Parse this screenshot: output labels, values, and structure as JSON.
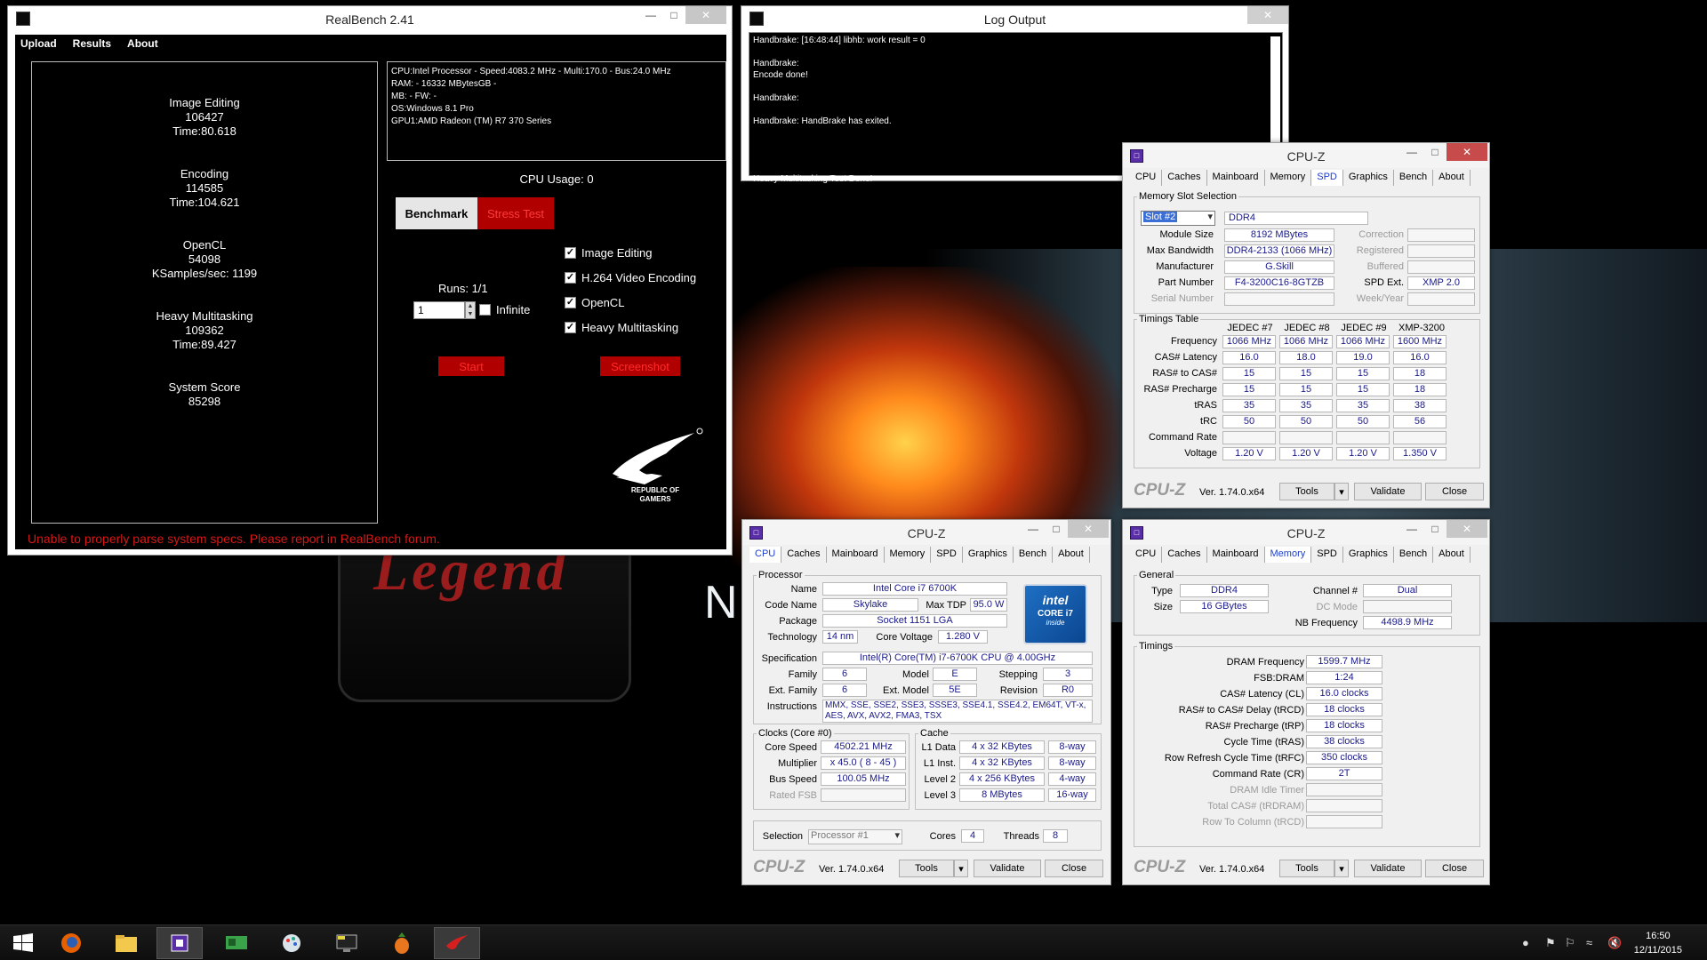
{
  "desktop": {
    "slogan": "N",
    "logo_word": "Legend"
  },
  "realbench": {
    "title": "RealBench 2.41",
    "menu": [
      "Upload",
      "Results",
      "About"
    ],
    "scores": [
      {
        "name": "Image Editing",
        "score": "106427",
        "detail": "Time:80.618"
      },
      {
        "name": "Encoding",
        "score": "114585",
        "detail": "Time:104.621"
      },
      {
        "name": "OpenCL",
        "score": "54098",
        "detail": "KSamples/sec: 1199"
      },
      {
        "name": "Heavy Multitasking",
        "score": "109362",
        "detail": "Time:89.427"
      },
      {
        "name": "System Score",
        "score": "85298",
        "detail": ""
      }
    ],
    "specs": [
      "CPU:Intel Processor - Speed:4083.2 MHz - Multi:170.0 - Bus:24.0 MHz",
      "RAM: - 16332 MBytesGB -",
      "MB: - FW: -",
      "OS:Windows 8.1 Pro",
      "GPU1:AMD Radeon (TM) R7 370 Series"
    ],
    "cpu_usage": "CPU Usage: 0",
    "benchmark_label": "Benchmark",
    "stress_label": "Stress Test",
    "runs_label": "Runs: 1/1",
    "runs_value": "1",
    "infinite_label": "Infinite",
    "tests": [
      "Image Editing",
      "H.264 Video Encoding",
      "OpenCL",
      "Heavy Multitasking"
    ],
    "start_label": "Start",
    "screenshot_label": "Screenshot",
    "rog_text": [
      "REPUBLIC OF",
      "GAMERS"
    ],
    "error": "Unable to properly parse system specs. Please report in RealBench forum."
  },
  "log": {
    "title": "Log Output",
    "lines": [
      "Handbrake: [16:48:44] libhb: work result = 0",
      "",
      "Handbrake:",
      "Encode done!",
      "",
      "Handbrake:",
      "",
      "Handbrake: HandBrake has exited.",
      "",
      "",
      "",
      "",
      "Heavy Multitasking Test Done!"
    ]
  },
  "cpuz_common": {
    "title": "CPU-Z",
    "tabs": [
      "CPU",
      "Caches",
      "Mainboard",
      "Memory",
      "SPD",
      "Graphics",
      "Bench",
      "About"
    ],
    "brand": "CPU-Z",
    "version": "Ver. 1.74.0.x64",
    "tools_label": "Tools",
    "validate_label": "Validate",
    "close_label": "Close"
  },
  "spd": {
    "group_slot": "Memory Slot Selection",
    "slot": "Slot #2",
    "type": "DDR4",
    "module_size": "8192 MBytes",
    "max_bandwidth": "DDR4-2133 (1066 MHz)",
    "manufacturer": "G.Skill",
    "part_number": "F4-3200C16-8GTZB",
    "serial_number": "",
    "correction": "",
    "registered": "",
    "buffered": "",
    "spd_ext": "XMP 2.0",
    "week_year": "",
    "labels": {
      "module_size": "Module Size",
      "max_bandwidth": "Max Bandwidth",
      "manufacturer": "Manufacturer",
      "part_number": "Part Number",
      "serial_number": "Serial Number",
      "correction": "Correction",
      "registered": "Registered",
      "buffered": "Buffered",
      "spd_ext": "SPD Ext.",
      "week_year": "Week/Year"
    },
    "group_timings": "Timings Table",
    "columns": [
      "JEDEC #7",
      "JEDEC #8",
      "JEDEC #9",
      "XMP-3200"
    ],
    "rows": [
      {
        "label": "Frequency",
        "values": [
          "1066 MHz",
          "1066 MHz",
          "1066 MHz",
          "1600 MHz"
        ]
      },
      {
        "label": "CAS# Latency",
        "values": [
          "16.0",
          "18.0",
          "19.0",
          "16.0"
        ]
      },
      {
        "label": "RAS# to CAS#",
        "values": [
          "15",
          "15",
          "15",
          "18"
        ]
      },
      {
        "label": "RAS# Precharge",
        "values": [
          "15",
          "15",
          "15",
          "18"
        ]
      },
      {
        "label": "tRAS",
        "values": [
          "35",
          "35",
          "35",
          "38"
        ]
      },
      {
        "label": "tRC",
        "values": [
          "50",
          "50",
          "50",
          "56"
        ]
      },
      {
        "label": "Command Rate",
        "values": [
          "",
          "",
          "",
          ""
        ]
      },
      {
        "label": "Voltage",
        "values": [
          "1.20 V",
          "1.20 V",
          "1.20 V",
          "1.350 V"
        ]
      }
    ]
  },
  "cpu": {
    "group_processor": "Processor",
    "name": "Intel Core i7 6700K",
    "code_name": "Skylake",
    "max_tdp": "95.0 W",
    "package": "Socket 1151 LGA",
    "technology": "14 nm",
    "core_voltage": "1.280 V",
    "specification": "Intel(R) Core(TM) i7-6700K CPU @ 4.00GHz",
    "family": "6",
    "model": "E",
    "stepping": "3",
    "ext_family": "6",
    "ext_model": "5E",
    "revision": "R0",
    "instructions": [
      "MMX, SSE, SSE2, SSE3, SSSE3, SSE4.1, SSE4.2, EM64T, VT-x,",
      "AES, AVX, AVX2, FMA3, TSX"
    ],
    "labels": {
      "name": "Name",
      "code_name": "Code Name",
      "max_tdp": "Max TDP",
      "package": "Package",
      "technology": "Technology",
      "core_voltage": "Core Voltage",
      "specification": "Specification",
      "family": "Family",
      "model": "Model",
      "stepping": "Stepping",
      "ext_family": "Ext. Family",
      "ext_model": "Ext. Model",
      "revision": "Revision",
      "instructions": "Instructions"
    },
    "intel_badge": [
      "intel",
      "CORE i7",
      "inside"
    ],
    "group_clocks": "Clocks (Core #0)",
    "core_speed": "4502.21 MHz",
    "multiplier": "x 45.0 ( 8 - 45 )",
    "bus_speed": "100.05 MHz",
    "rated_fsb": "",
    "clock_labels": {
      "core_speed": "Core Speed",
      "multiplier": "Multiplier",
      "bus_speed": "Bus Speed",
      "rated_fsb": "Rated FSB"
    },
    "group_cache": "Cache",
    "cache": [
      {
        "label": "L1 Data",
        "size": "4 x 32 KBytes",
        "way": "8-way"
      },
      {
        "label": "L1 Inst.",
        "size": "4 x 32 KBytes",
        "way": "8-way"
      },
      {
        "label": "Level 2",
        "size": "4 x 256 KBytes",
        "way": "4-way"
      },
      {
        "label": "Level 3",
        "size": "8 MBytes",
        "way": "16-way"
      }
    ],
    "selection_label": "Selection",
    "selection": "Processor #1",
    "cores_label": "Cores",
    "cores": "4",
    "threads_label": "Threads",
    "threads": "8"
  },
  "memory": {
    "group_general": "General",
    "type_label": "Type",
    "type": "DDR4",
    "size_label": "Size",
    "size": "16 GBytes",
    "channel_label": "Channel #",
    "channel": "Dual",
    "dc_mode_label": "DC Mode",
    "dc_mode": "",
    "nb_freq_label": "NB Frequency",
    "nb_freq": "4498.9 MHz",
    "group_timings": "Timings",
    "timings": [
      {
        "label": "DRAM Frequency",
        "value": "1599.7 MHz",
        "dim": false
      },
      {
        "label": "FSB:DRAM",
        "value": "1:24",
        "dim": false
      },
      {
        "label": "CAS# Latency (CL)",
        "value": "16.0 clocks",
        "dim": false
      },
      {
        "label": "RAS# to CAS# Delay (tRCD)",
        "value": "18 clocks",
        "dim": false
      },
      {
        "label": "RAS# Precharge (tRP)",
        "value": "18 clocks",
        "dim": false
      },
      {
        "label": "Cycle Time (tRAS)",
        "value": "38 clocks",
        "dim": false
      },
      {
        "label": "Row Refresh Cycle Time (tRFC)",
        "value": "350 clocks",
        "dim": false
      },
      {
        "label": "Command Rate (CR)",
        "value": "2T",
        "dim": false
      },
      {
        "label": "DRAM Idle Timer",
        "value": "",
        "dim": true
      },
      {
        "label": "Total CAS# (tRDRAM)",
        "value": "",
        "dim": true
      },
      {
        "label": "Row To Column (tRCD)",
        "value": "",
        "dim": true
      }
    ]
  },
  "taskbar": {
    "time": "16:50",
    "date": "12/11/2015"
  }
}
